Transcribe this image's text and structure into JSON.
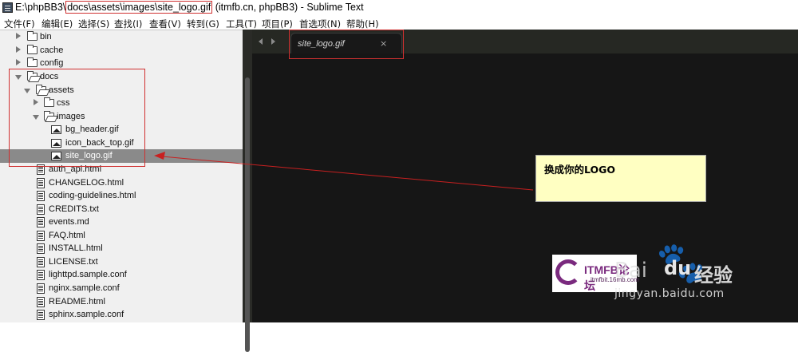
{
  "titlebar": {
    "path_prefix": "E:\\phpBB3\\",
    "path_boxed": "docs\\assets\\images\\site_logo.gif",
    "path_suffix": " (itmfb.cn, phpBB3) - Sublime Text"
  },
  "menu": [
    "文件(F)",
    "编辑(E)",
    "选择(S)",
    "查找(I)",
    "查看(V)",
    "转到(G)",
    "工具(T)",
    "项目(P)",
    "首选项(N)",
    "帮助(H)"
  ],
  "tree": [
    {
      "label": "bin",
      "kind": "folder",
      "state": "closed"
    },
    {
      "label": "cache",
      "kind": "folder",
      "state": "closed"
    },
    {
      "label": "config",
      "kind": "folder",
      "state": "closed"
    },
    {
      "label": "docs",
      "kind": "folder",
      "state": "open"
    },
    {
      "label": "assets",
      "kind": "folder",
      "state": "open"
    },
    {
      "label": "css",
      "kind": "folder",
      "state": "closed"
    },
    {
      "label": "images",
      "kind": "folder",
      "state": "open"
    },
    {
      "label": "bg_header.gif",
      "kind": "image"
    },
    {
      "label": "icon_back_top.gif",
      "kind": "image"
    },
    {
      "label": "site_logo.gif",
      "kind": "image",
      "selected": true
    },
    {
      "label": "auth_api.html",
      "kind": "file"
    },
    {
      "label": "CHANGELOG.html",
      "kind": "file"
    },
    {
      "label": "coding-guidelines.html",
      "kind": "file"
    },
    {
      "label": "CREDITS.txt",
      "kind": "file"
    },
    {
      "label": "events.md",
      "kind": "file"
    },
    {
      "label": "FAQ.html",
      "kind": "file"
    },
    {
      "label": "INSTALL.html",
      "kind": "file"
    },
    {
      "label": "LICENSE.txt",
      "kind": "file"
    },
    {
      "label": "lighttpd.sample.conf",
      "kind": "file"
    },
    {
      "label": "nginx.sample.conf",
      "kind": "file"
    },
    {
      "label": "README.html",
      "kind": "file"
    },
    {
      "label": "sphinx.sample.conf",
      "kind": "file"
    }
  ],
  "tab": {
    "label": "site_logo.gif",
    "close": "×"
  },
  "callout": {
    "text": "换成你的LOGO"
  },
  "watermark": {
    "brand": "ITMFB论坛",
    "url": "itmfbit.16mb.com"
  },
  "baidu": {
    "bai": "Bai",
    "du": "du",
    "jingyan": "经验",
    "site": "jingyan.baidu.com"
  },
  "colors": {
    "annotation": "#d03030",
    "callout_bg": "#ffffc2",
    "editor_bg": "#161616",
    "sidebar_bg": "#f0f0f0",
    "selected_row": "#8a8a8a"
  }
}
